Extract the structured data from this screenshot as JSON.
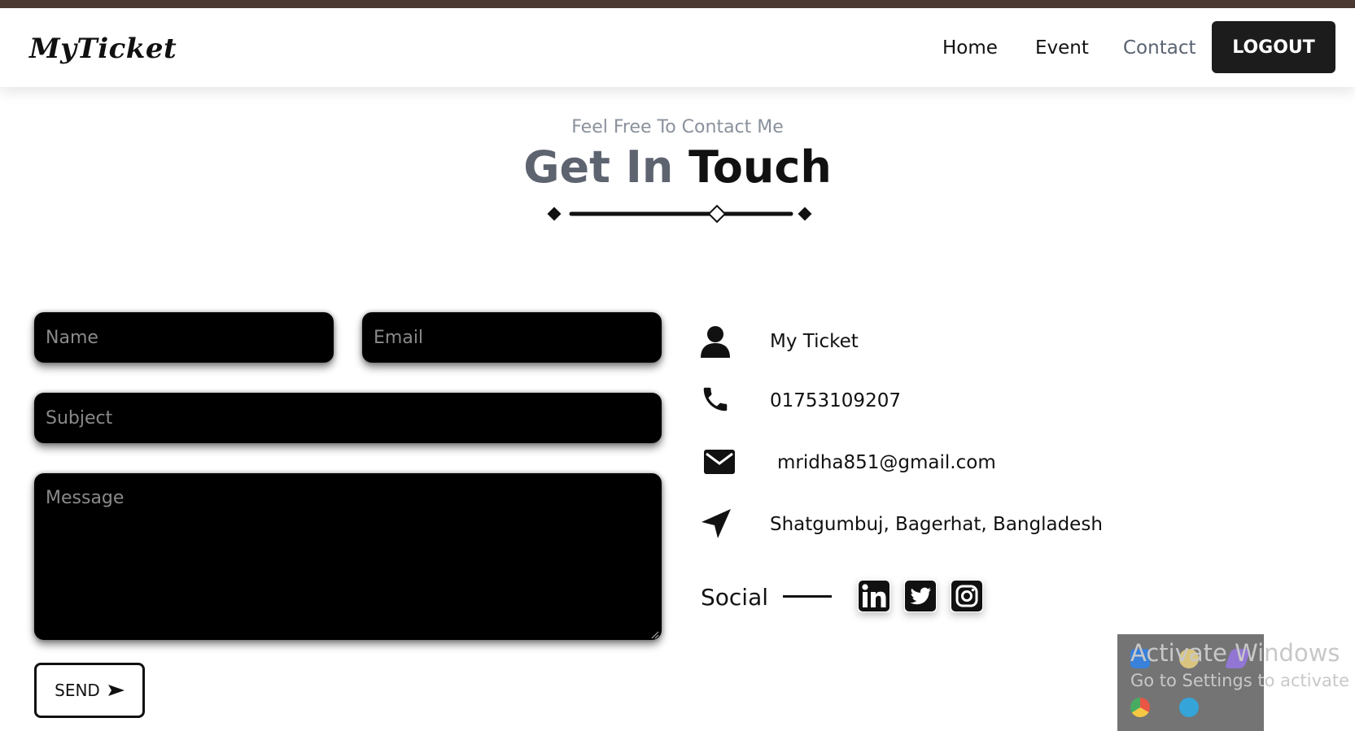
{
  "brand": {
    "logo": "MyTicket"
  },
  "nav": {
    "home": "Home",
    "event": "Event",
    "contact": "Contact",
    "logout": "LOGOUT"
  },
  "hero": {
    "pretitle": "Feel Free To Contact Me",
    "title_part1": "Get In",
    "title_part2": "Touch"
  },
  "form": {
    "name_placeholder": "Name",
    "email_placeholder": "Email",
    "subject_placeholder": "Subject",
    "message_placeholder": "Message",
    "send_label": "SEND"
  },
  "contact_info": {
    "name": "My Ticket",
    "phone": "01753109207",
    "email": "mridha851@gmail.com",
    "address": "Shatgumbuj, Bagerhat, Bangladesh"
  },
  "social": {
    "label": "Social",
    "icons": [
      "linkedin-icon",
      "twitter-icon",
      "instagram-icon"
    ]
  },
  "windows_watermark": {
    "line1": "Activate Windows",
    "line2": "Go to Settings to activate Wi"
  },
  "colors": {
    "top_strip": "#4a3a33",
    "logout_bg": "#1c1c1c",
    "field_bg": "#000000",
    "muted_text": "#5d6470"
  }
}
